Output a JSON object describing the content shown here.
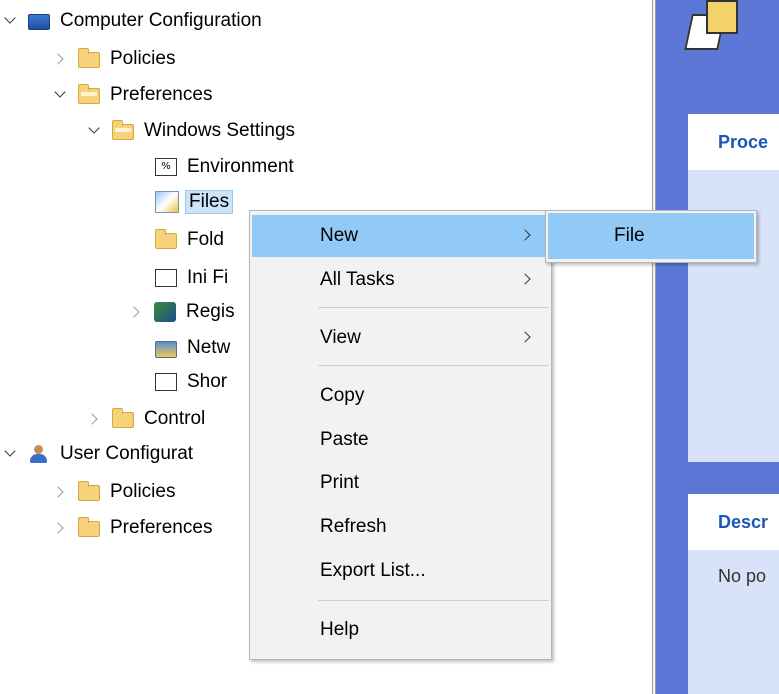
{
  "tree": {
    "computer_config": "Computer Configuration",
    "policies": "Policies",
    "preferences": "Preferences",
    "windows_settings": "Windows Settings",
    "environment": "Environment",
    "files": "Files",
    "folders": "Fold",
    "ini_files": "Ini Fi",
    "registry": "Regis",
    "network_shares": "Netw",
    "shortcuts": "Shor",
    "control_panel": "Control",
    "user_config": "User Configurat",
    "user_policies": "Policies",
    "user_preferences": "Preferences",
    "env_icon_glyph": "%"
  },
  "right_pane": {
    "processing_header": "Proce",
    "description_header": "Descr",
    "description_text": "No po"
  },
  "context_menu": {
    "new": "New",
    "all_tasks": "All Tasks",
    "view": "View",
    "copy": "Copy",
    "paste": "Paste",
    "print": "Print",
    "refresh": "Refresh",
    "export_list": "Export List...",
    "help": "Help"
  },
  "submenu": {
    "file": "File"
  },
  "colors": {
    "highlight": "#91c9f7",
    "selection": "#cce4f7",
    "pane_blue": "#5b78d6",
    "header_text": "#1c56b6"
  }
}
